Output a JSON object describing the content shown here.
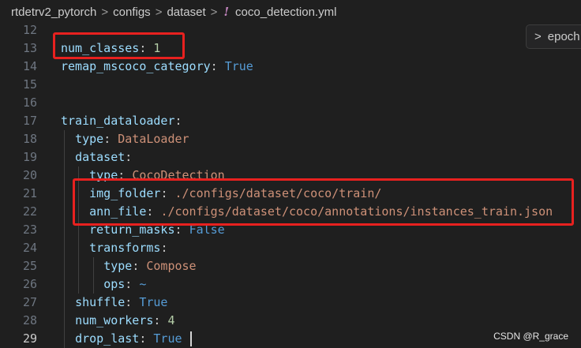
{
  "breadcrumb": {
    "items": [
      "rtdetrv2_pytorch",
      "configs",
      "dataset"
    ],
    "file_icon": "!",
    "file_name": "coco_detection.yml",
    "separator": ">"
  },
  "sticky_scroll": {
    "chevron": ">",
    "label": "epoch"
  },
  "editor": {
    "active_line": 29,
    "lines": [
      {
        "n": "12",
        "tokens": []
      },
      {
        "n": "13",
        "tokens": [
          {
            "t": "k",
            "v": "num_classes"
          },
          {
            "t": "p",
            "v": ": "
          },
          {
            "t": "n",
            "v": "1"
          }
        ]
      },
      {
        "n": "14",
        "tokens": [
          {
            "t": "k",
            "v": "remap_mscoco_category"
          },
          {
            "t": "p",
            "v": ": "
          },
          {
            "t": "b",
            "v": "True"
          }
        ]
      },
      {
        "n": "15",
        "tokens": []
      },
      {
        "n": "16",
        "tokens": []
      },
      {
        "n": "17",
        "tokens": [
          {
            "t": "k",
            "v": "train_dataloader"
          },
          {
            "t": "p",
            "v": ":"
          }
        ]
      },
      {
        "n": "18",
        "tokens": [
          {
            "t": "p",
            "v": "  "
          },
          {
            "t": "k",
            "v": "type"
          },
          {
            "t": "p",
            "v": ": "
          },
          {
            "t": "s",
            "v": "DataLoader"
          }
        ]
      },
      {
        "n": "19",
        "tokens": [
          {
            "t": "p",
            "v": "  "
          },
          {
            "t": "k",
            "v": "dataset"
          },
          {
            "t": "p",
            "v": ":"
          }
        ]
      },
      {
        "n": "20",
        "tokens": [
          {
            "t": "p",
            "v": "    "
          },
          {
            "t": "k",
            "v": "type"
          },
          {
            "t": "p",
            "v": ": "
          },
          {
            "t": "s",
            "v": "CocoDetection"
          }
        ]
      },
      {
        "n": "21",
        "tokens": [
          {
            "t": "p",
            "v": "    "
          },
          {
            "t": "k",
            "v": "img_folder"
          },
          {
            "t": "p",
            "v": ": "
          },
          {
            "t": "s",
            "v": "./configs/dataset/coco/train/"
          }
        ]
      },
      {
        "n": "22",
        "tokens": [
          {
            "t": "p",
            "v": "    "
          },
          {
            "t": "k",
            "v": "ann_file"
          },
          {
            "t": "p",
            "v": ": "
          },
          {
            "t": "s",
            "v": "./configs/dataset/coco/annotations/instances_train.json"
          }
        ]
      },
      {
        "n": "23",
        "tokens": [
          {
            "t": "p",
            "v": "    "
          },
          {
            "t": "k",
            "v": "return_masks"
          },
          {
            "t": "p",
            "v": ": "
          },
          {
            "t": "b",
            "v": "False"
          }
        ]
      },
      {
        "n": "24",
        "tokens": [
          {
            "t": "p",
            "v": "    "
          },
          {
            "t": "k",
            "v": "transforms"
          },
          {
            "t": "p",
            "v": ":"
          }
        ]
      },
      {
        "n": "25",
        "tokens": [
          {
            "t": "p",
            "v": "      "
          },
          {
            "t": "k",
            "v": "type"
          },
          {
            "t": "p",
            "v": ": "
          },
          {
            "t": "s",
            "v": "Compose"
          }
        ]
      },
      {
        "n": "26",
        "tokens": [
          {
            "t": "p",
            "v": "      "
          },
          {
            "t": "k",
            "v": "ops"
          },
          {
            "t": "p",
            "v": ": "
          },
          {
            "t": "b",
            "v": "~"
          }
        ]
      },
      {
        "n": "27",
        "tokens": [
          {
            "t": "p",
            "v": "  "
          },
          {
            "t": "k",
            "v": "shuffle"
          },
          {
            "t": "p",
            "v": ": "
          },
          {
            "t": "b",
            "v": "True"
          }
        ]
      },
      {
        "n": "28",
        "tokens": [
          {
            "t": "p",
            "v": "  "
          },
          {
            "t": "k",
            "v": "num_workers"
          },
          {
            "t": "p",
            "v": ": "
          },
          {
            "t": "n",
            "v": "4"
          }
        ]
      },
      {
        "n": "29",
        "tokens": [
          {
            "t": "p",
            "v": "  "
          },
          {
            "t": "k",
            "v": "drop_last"
          },
          {
            "t": "p",
            "v": ": "
          },
          {
            "t": "b",
            "v": "True"
          }
        ]
      }
    ]
  },
  "watermark": "CSDN @R_grace",
  "colors": {
    "background": "#1f1f1f",
    "key": "#9cdcfe",
    "string": "#ce9178",
    "boolean": "#569cd6",
    "number": "#b5cea8",
    "highlight_box": "#e8211f"
  }
}
